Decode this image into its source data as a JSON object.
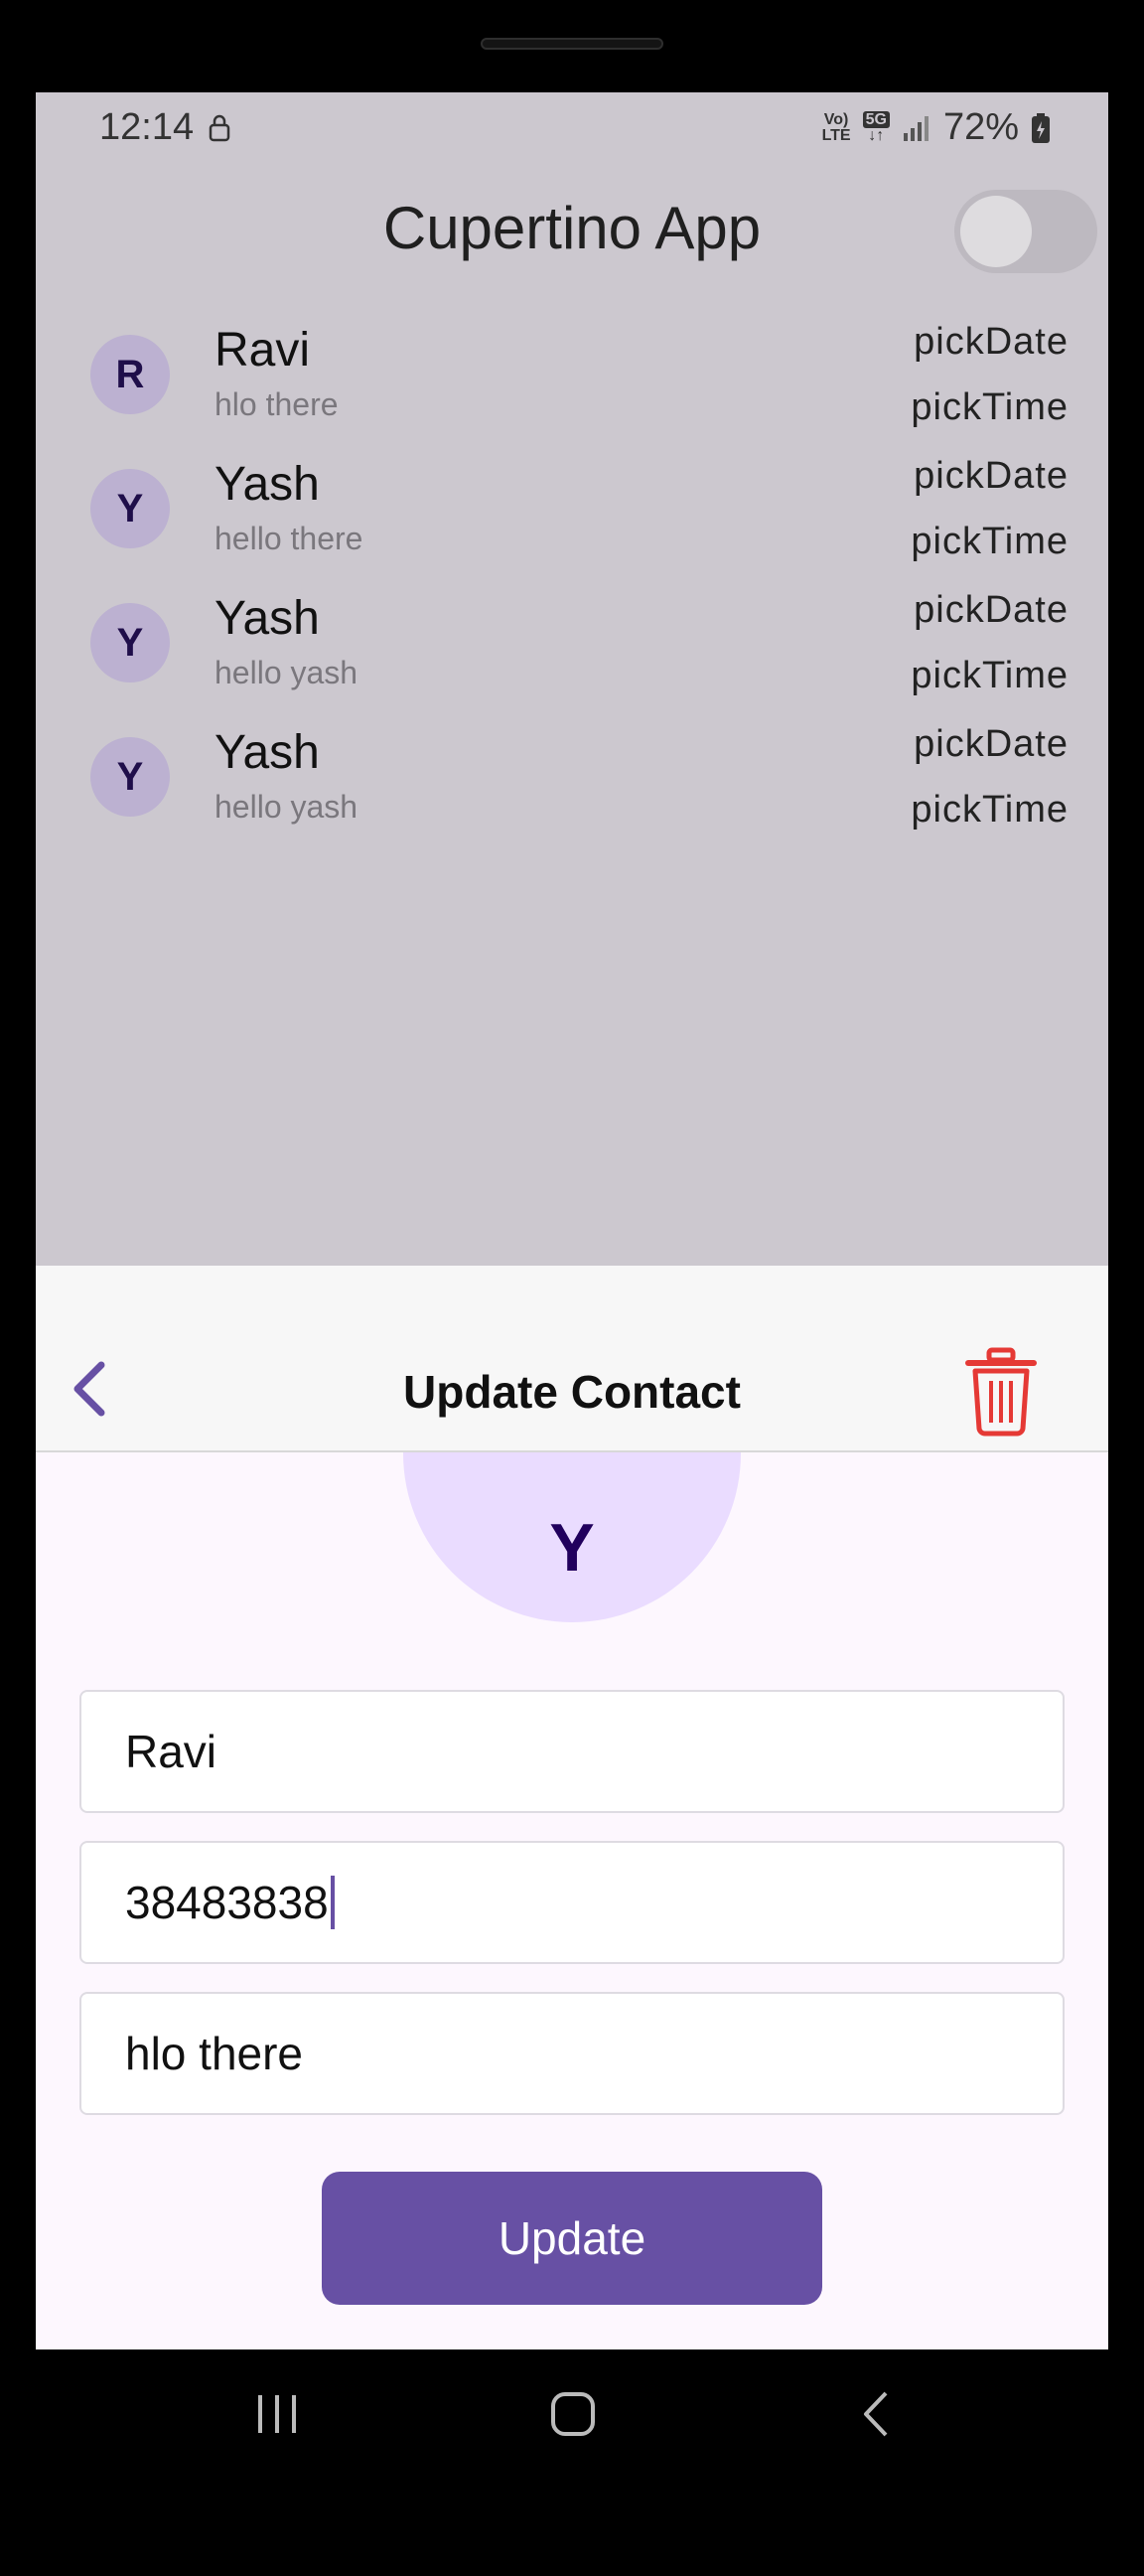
{
  "status_bar": {
    "time": "12:14",
    "volte": "Vo)\nLTE",
    "network": "5G",
    "battery": "72%"
  },
  "app": {
    "title": "Cupertino App",
    "toggle_on": false,
    "contacts": [
      {
        "initial": "R",
        "name": "Ravi",
        "message": "hlo there",
        "date_label": "pickDate",
        "time_label": "pickTime"
      },
      {
        "initial": "Y",
        "name": "Yash",
        "message": "hello there",
        "date_label": "pickDate",
        "time_label": "pickTime"
      },
      {
        "initial": "Y",
        "name": "Yash",
        "message": "hello yash",
        "date_label": "pickDate",
        "time_label": "pickTime"
      },
      {
        "initial": "Y",
        "name": "Yash",
        "message": "hello yash",
        "date_label": "pickDate",
        "time_label": "pickTime"
      }
    ]
  },
  "sheet": {
    "title": "Update Contact",
    "avatar_initial": "Y",
    "fields": {
      "name": "Ravi",
      "phone": "38483838",
      "message": "hlo there"
    },
    "update_label": "Update"
  },
  "colors": {
    "accent": "#6750a4",
    "delete": "#e53935",
    "avatar_bg": "#eadcff"
  }
}
